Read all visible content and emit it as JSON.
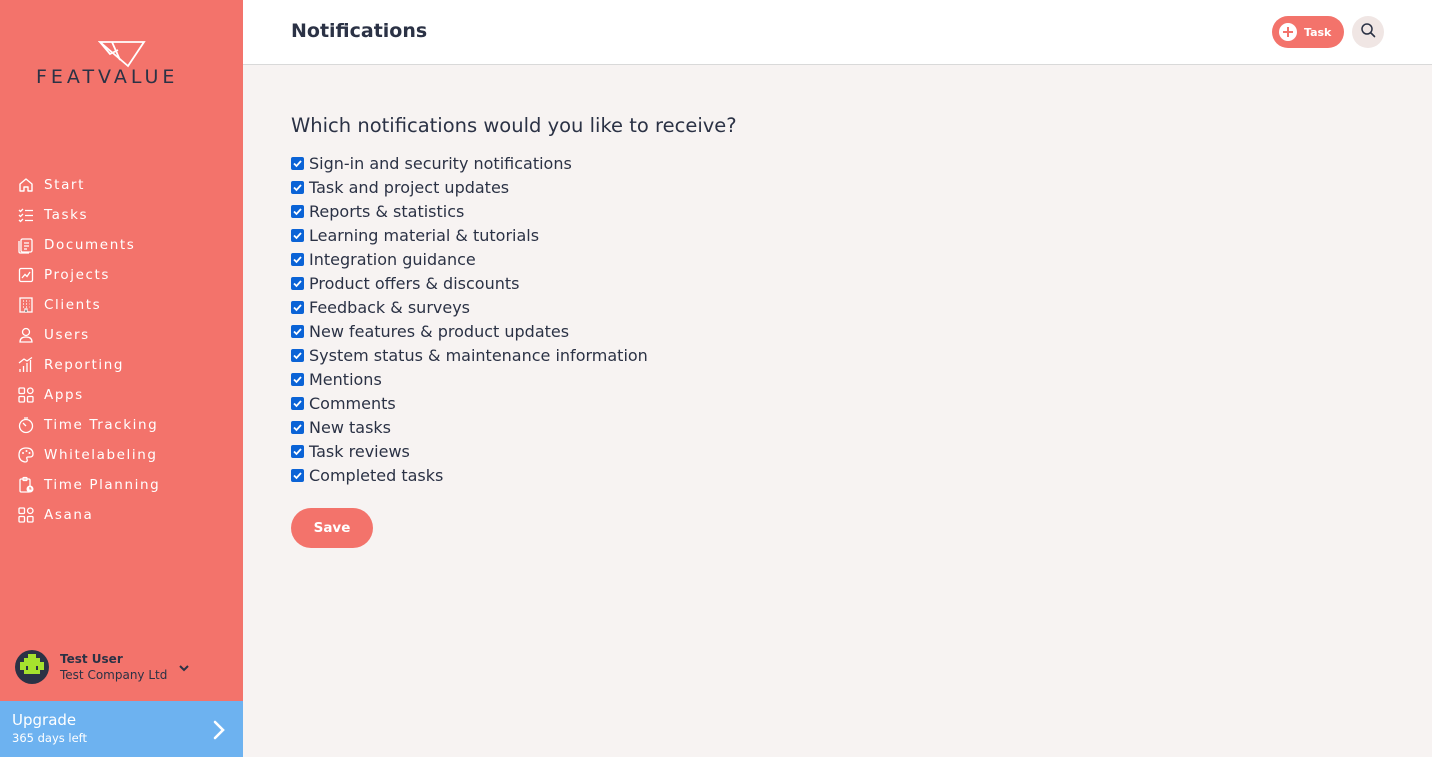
{
  "brand": {
    "name": "FEATVALUE",
    "accent": "#f3736b",
    "upgrade_color": "#6db2f0",
    "text_color": "#2b3245"
  },
  "sidebar": {
    "items": [
      {
        "label": "Start",
        "icon": "home-icon"
      },
      {
        "label": "Tasks",
        "icon": "tasks-list-icon"
      },
      {
        "label": "Documents",
        "icon": "documents-icon"
      },
      {
        "label": "Projects",
        "icon": "projects-chart-icon"
      },
      {
        "label": "Clients",
        "icon": "building-icon"
      },
      {
        "label": "Users",
        "icon": "user-icon"
      },
      {
        "label": "Reporting",
        "icon": "reporting-bars-icon"
      },
      {
        "label": "Apps",
        "icon": "apps-grid-icon"
      },
      {
        "label": "Time Tracking",
        "icon": "timer-icon"
      },
      {
        "label": "Whitelabeling",
        "icon": "palette-icon"
      },
      {
        "label": "Time Planning",
        "icon": "clipboard-clock-icon"
      },
      {
        "label": "Asana",
        "icon": "apps-grid-icon"
      }
    ]
  },
  "user": {
    "name": "Test User",
    "company": "Test Company Ltd"
  },
  "upgrade": {
    "title": "Upgrade",
    "subtitle": "365 days left"
  },
  "header": {
    "title": "Notifications",
    "task_label": "Task"
  },
  "main": {
    "question": "Which notifications would you like to receive?",
    "options": [
      {
        "label": "Sign-in and security notifications",
        "checked": true
      },
      {
        "label": "Task and project updates",
        "checked": true
      },
      {
        "label": "Reports & statistics",
        "checked": true
      },
      {
        "label": "Learning material & tutorials",
        "checked": true
      },
      {
        "label": "Integration guidance",
        "checked": true
      },
      {
        "label": "Product offers & discounts",
        "checked": true
      },
      {
        "label": "Feedback & surveys",
        "checked": true
      },
      {
        "label": "New features & product updates",
        "checked": true
      },
      {
        "label": "System status & maintenance information",
        "checked": true
      },
      {
        "label": "Mentions",
        "checked": true
      },
      {
        "label": "Comments",
        "checked": true
      },
      {
        "label": "New tasks",
        "checked": true
      },
      {
        "label": "Task reviews",
        "checked": true
      },
      {
        "label": "Completed tasks",
        "checked": true
      }
    ],
    "save_label": "Save"
  }
}
